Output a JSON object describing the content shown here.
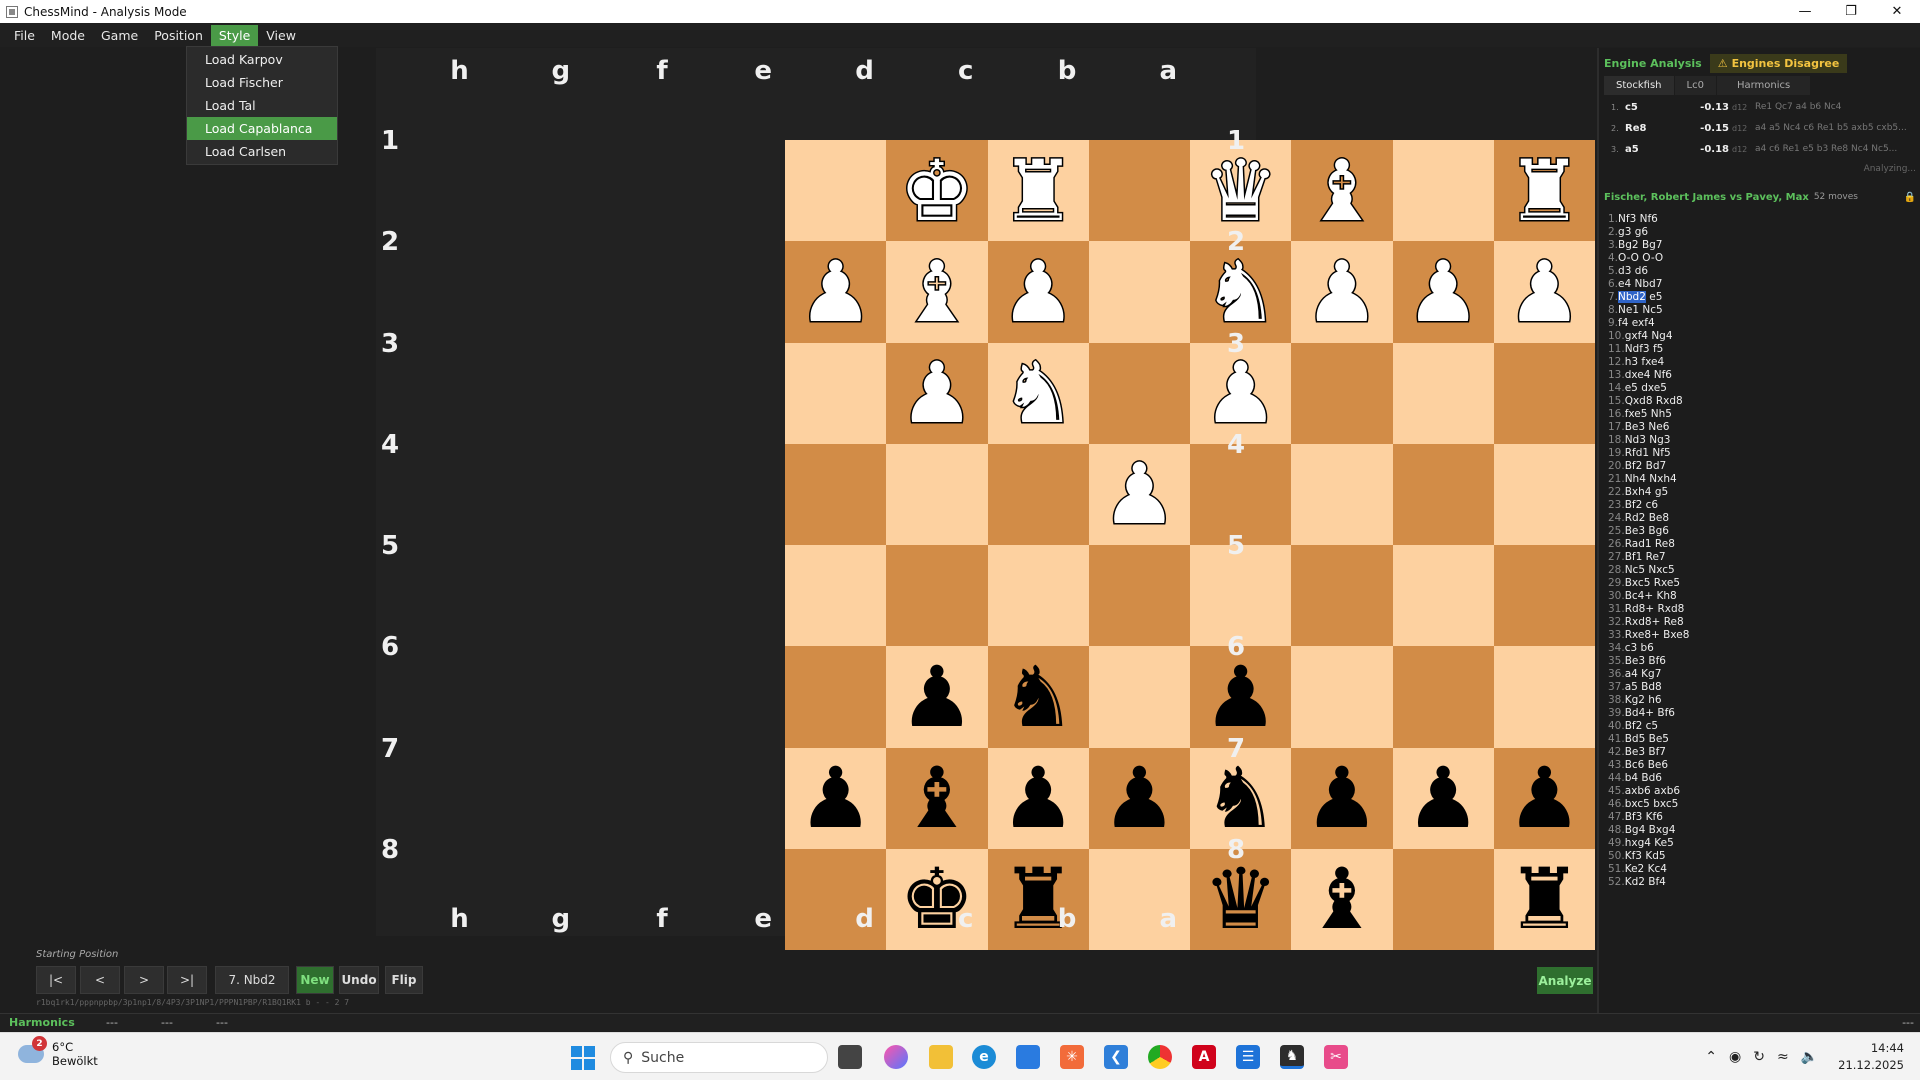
{
  "window": {
    "title": "ChessMind - Analysis Mode"
  },
  "menubar": {
    "items": [
      "File",
      "Mode",
      "Game",
      "Position",
      "Style",
      "View"
    ],
    "active": "Style"
  },
  "style_menu": {
    "items": [
      "Load Karpov",
      "Load Fischer",
      "Load Tal",
      "Load Capablanca",
      "Load Carlsen"
    ],
    "selected": "Load Capablanca"
  },
  "board": {
    "files": [
      "h",
      "g",
      "f",
      "e",
      "d",
      "c",
      "b",
      "a"
    ],
    "ranks": [
      "1",
      "2",
      "3",
      "4",
      "5",
      "6",
      "7",
      "8"
    ],
    "rows": [
      [
        "",
        "wK",
        "wR",
        "",
        "wQ",
        "wB",
        "",
        "wR"
      ],
      [
        "wP",
        "wB",
        "wP",
        "",
        "wN",
        "wP",
        "wP",
        "wP"
      ],
      [
        "",
        "wP",
        "wN",
        "",
        "wP",
        "",
        "",
        ""
      ],
      [
        "",
        "",
        "",
        "wP",
        "",
        "",
        "",
        ""
      ],
      [
        "",
        "",
        "",
        "",
        "",
        "",
        "",
        ""
      ],
      [
        "",
        "bP",
        "bN",
        "",
        "bP",
        "",
        "",
        ""
      ],
      [
        "bP",
        "bB",
        "bP",
        "bP",
        "bN",
        "bP",
        "bP",
        "bP"
      ],
      [
        "",
        "bK",
        "bR",
        "",
        "bQ",
        "bB",
        "",
        "bR"
      ]
    ],
    "colors": {
      "light": "#fdd1a0",
      "dark": "#d28c47"
    }
  },
  "controls": {
    "status": "Starting Position",
    "first": "|<",
    "prev": "<",
    "next": ">",
    "last": ">|",
    "current_move": "7. Nbd2",
    "new": "New",
    "undo": "Undo",
    "flip": "Flip",
    "fen": "r1bq1rk1/pppnppbp/3p1np1/8/4P3/3P1NP1/PPPN1PBP/R1BQ1RK1 b - - 2 7",
    "analyze": "Analyze"
  },
  "engine_bar": {
    "name": "Harmonics",
    "values": [
      "---",
      "---",
      "---"
    ],
    "right": "---"
  },
  "analysis": {
    "title": "Engine Analysis",
    "warning": "Engines Disagree",
    "tabs": [
      "Stockfish",
      "Lc0",
      "Harmonics"
    ],
    "active_tab": "Stockfish",
    "lines": [
      {
        "num": "1.",
        "move": "c5",
        "score": "-0.13",
        "depth": "d12",
        "pv": "Re1 Qc7 a4 b6 Nc4"
      },
      {
        "num": "2.",
        "move": "Re8",
        "score": "-0.15",
        "depth": "d12",
        "pv": "a4 a5 Nc4 c6 Re1 b5 axb5 cxb5..."
      },
      {
        "num": "3.",
        "move": "a5",
        "score": "-0.18",
        "depth": "d12",
        "pv": "a4 c6 Re1 e5 b3 Re8 Nc4 Nc5..."
      }
    ],
    "status": "Analyzing..."
  },
  "game": {
    "players": "Fischer, Robert James vs Pavey, Max",
    "move_count": "52 moves",
    "highlight_index": 6,
    "moves": [
      [
        "1.",
        "Nf3",
        "Nf6"
      ],
      [
        "2.",
        "g3",
        "g6"
      ],
      [
        "3.",
        "Bg2",
        "Bg7"
      ],
      [
        "4.",
        "O-O",
        "O-O"
      ],
      [
        "5.",
        "d3",
        "d6"
      ],
      [
        "6.",
        "e4",
        "Nbd7"
      ],
      [
        "7.",
        "Nbd2",
        "e5"
      ],
      [
        "8.",
        "Ne1",
        "Nc5"
      ],
      [
        "9.",
        "f4",
        "exf4"
      ],
      [
        "10.",
        "gxf4",
        "Ng4"
      ],
      [
        "11.",
        "Ndf3",
        "f5"
      ],
      [
        "12.",
        "h3",
        "fxe4"
      ],
      [
        "13.",
        "dxe4",
        "Nf6"
      ],
      [
        "14.",
        "e5",
        "dxe5"
      ],
      [
        "15.",
        "Qxd8",
        "Rxd8"
      ],
      [
        "16.",
        "fxe5",
        "Nh5"
      ],
      [
        "17.",
        "Be3",
        "Ne6"
      ],
      [
        "18.",
        "Nd3",
        "Ng3"
      ],
      [
        "19.",
        "Rfd1",
        "Nf5"
      ],
      [
        "20.",
        "Bf2",
        "Bd7"
      ],
      [
        "21.",
        "Nh4",
        "Nxh4"
      ],
      [
        "22.",
        "Bxh4",
        "g5"
      ],
      [
        "23.",
        "Bf2",
        "c6"
      ],
      [
        "24.",
        "Rd2",
        "Be8"
      ],
      [
        "25.",
        "Be3",
        "Bg6"
      ],
      [
        "26.",
        "Rad1",
        "Re8"
      ],
      [
        "27.",
        "Bf1",
        "Re7"
      ],
      [
        "28.",
        "Nc5",
        "Nxc5"
      ],
      [
        "29.",
        "Bxc5",
        "Rxe5"
      ],
      [
        "30.",
        "Bc4+",
        "Kh8"
      ],
      [
        "31.",
        "Rd8+",
        "Rxd8"
      ],
      [
        "32.",
        "Rxd8+",
        "Re8"
      ],
      [
        "33.",
        "Rxe8+",
        "Bxe8"
      ],
      [
        "34.",
        "c3",
        "b6"
      ],
      [
        "35.",
        "Be3",
        "Bf6"
      ],
      [
        "36.",
        "a4",
        "Kg7"
      ],
      [
        "37.",
        "a5",
        "Bd8"
      ],
      [
        "38.",
        "Kg2",
        "h6"
      ],
      [
        "39.",
        "Bd4+",
        "Bf6"
      ],
      [
        "40.",
        "Bf2",
        "c5"
      ],
      [
        "41.",
        "Bd5",
        "Be5"
      ],
      [
        "42.",
        "Be3",
        "Bf7"
      ],
      [
        "43.",
        "Bc6",
        "Be6"
      ],
      [
        "44.",
        "b4",
        "Bd6"
      ],
      [
        "45.",
        "axb6",
        "axb6"
      ],
      [
        "46.",
        "bxc5",
        "bxc5"
      ],
      [
        "47.",
        "Bf3",
        "Kf6"
      ],
      [
        "48.",
        "Bg4",
        "Bxg4"
      ],
      [
        "49.",
        "hxg4",
        "Ke5"
      ],
      [
        "50.",
        "Kf3",
        "Kd5"
      ],
      [
        "51.",
        "Ke2",
        "Kc4"
      ],
      [
        "52.",
        "Kd2",
        "Bf4"
      ]
    ]
  },
  "taskbar": {
    "weather_temp": "6°C",
    "weather_desc": "Bewölkt",
    "weather_badge": "2",
    "search_placeholder": "Suche",
    "time": "14:44",
    "date": "21.12.2025"
  }
}
